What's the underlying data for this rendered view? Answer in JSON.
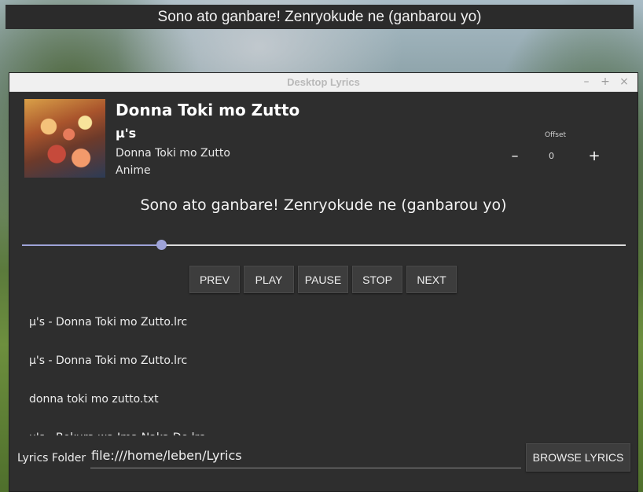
{
  "overlay": {
    "lyric": "Sono ato ganbare! Zenryokude ne (ganbarou yo)"
  },
  "window": {
    "title": "Desktop Lyrics",
    "controls": {
      "minimize": "–",
      "maximize": "+",
      "close": "×"
    }
  },
  "track": {
    "title": "Donna Toki mo Zutto",
    "artist": "µ's",
    "album": "Donna Toki mo Zutto",
    "genre": "Anime"
  },
  "offset": {
    "label": "Offset",
    "value": "0",
    "minus": "–",
    "plus": "+"
  },
  "current_lyric": "Sono ato ganbare! Zenryokude ne (ganbarou yo)",
  "progress": {
    "fraction": 0.23
  },
  "controls": [
    "PREV",
    "PLAY",
    "PAUSE",
    "STOP",
    "NEXT"
  ],
  "files": [
    "µ's - Donna Toki mo Zutto.lrc",
    "µ's - Donna Toki mo Zutto.lrc",
    "donna toki mo zutto.txt",
    "µ's - Bokura wa Ima Naka De.lrc"
  ],
  "folder": {
    "label": "Lyrics Folder",
    "value": "file:///home/leben/Lyrics"
  },
  "browse_label": "BROWSE LYRICS",
  "colors": {
    "accent": "#9ea3d8",
    "window_bg": "#2e2e2e",
    "button_bg": "#3d3d3d"
  }
}
